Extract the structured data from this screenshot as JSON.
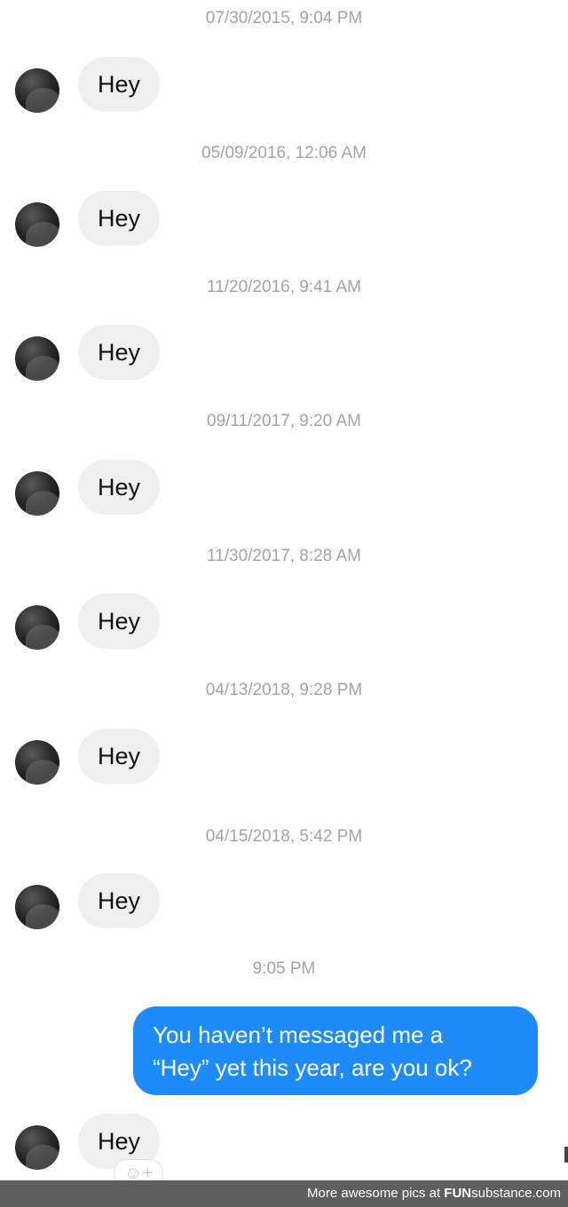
{
  "thread": [
    {
      "timestamp": "07/30/2015, 9:04 PM",
      "message": "Hey"
    },
    {
      "timestamp": "05/09/2016, 12:06 AM",
      "message": "Hey"
    },
    {
      "timestamp": "11/20/2016, 9:41 AM",
      "message": "Hey"
    },
    {
      "timestamp": "09/11/2017, 9:20 AM",
      "message": "Hey"
    },
    {
      "timestamp": "11/30/2017, 8:28 AM",
      "message": "Hey"
    },
    {
      "timestamp": "04/13/2018, 9:28 PM",
      "message": "Hey"
    },
    {
      "timestamp": "04/15/2018, 5:42 PM",
      "message": "Hey"
    }
  ],
  "reply": {
    "timestamp": "9:05 PM",
    "line1": "You haven’t messaged me a",
    "line2": "“Hey” yet this year, are you ok?"
  },
  "last_incoming": {
    "message": "Hey"
  },
  "reaction_button": {
    "icon": "smiley-add-icon",
    "glyph": "☺+"
  },
  "colors": {
    "incoming_bubble": "#efefef",
    "outgoing_bubble": "#1d8cf8",
    "timestamp_text": "#a3a3a3"
  },
  "footer": {
    "text": "More awesome pics at ",
    "brand_prefix": "FUN",
    "brand_suffix": "substance.com"
  }
}
